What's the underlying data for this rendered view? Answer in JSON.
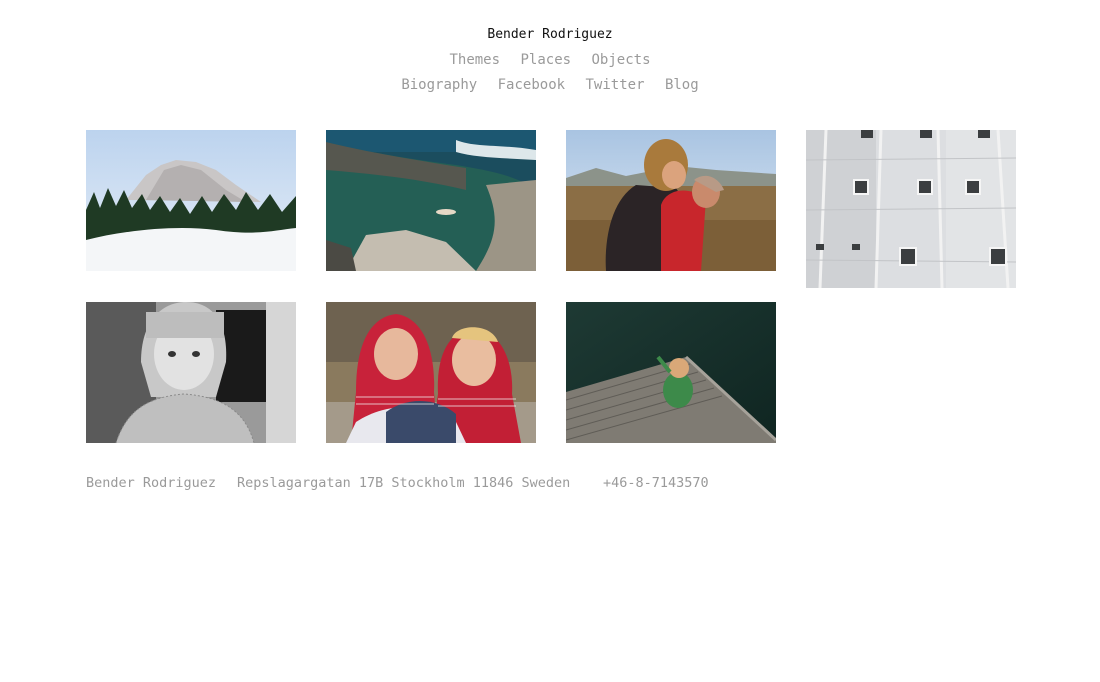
{
  "header": {
    "site_title": "Bender Rodriguez",
    "primary_nav": [
      {
        "label": "Themes"
      },
      {
        "label": "Places"
      },
      {
        "label": "Objects"
      }
    ],
    "secondary_nav": [
      {
        "label": "Biography"
      },
      {
        "label": "Facebook"
      },
      {
        "label": "Twitter"
      },
      {
        "label": "Blog"
      }
    ]
  },
  "gallery": {
    "photos": [
      {
        "name": "mountain-forest-snow-photo"
      },
      {
        "name": "rocky-coast-swimmer-photo"
      },
      {
        "name": "mother-hugging-child-photo"
      },
      {
        "name": "white-building-facade-photo"
      },
      {
        "name": "girl-black-white-portrait-photo"
      },
      {
        "name": "two-children-red-hoodies-photo"
      },
      {
        "name": "child-on-wooden-dock-photo"
      }
    ]
  },
  "footer": {
    "name": "Bender Rodriguez",
    "address": "Repslagargatan 17B Stockholm 11846 Sweden",
    "phone": "+46-8-7143570"
  },
  "colors": {
    "nav_text": "#9a9a9a",
    "title_text": "#111111",
    "background": "#ffffff"
  }
}
